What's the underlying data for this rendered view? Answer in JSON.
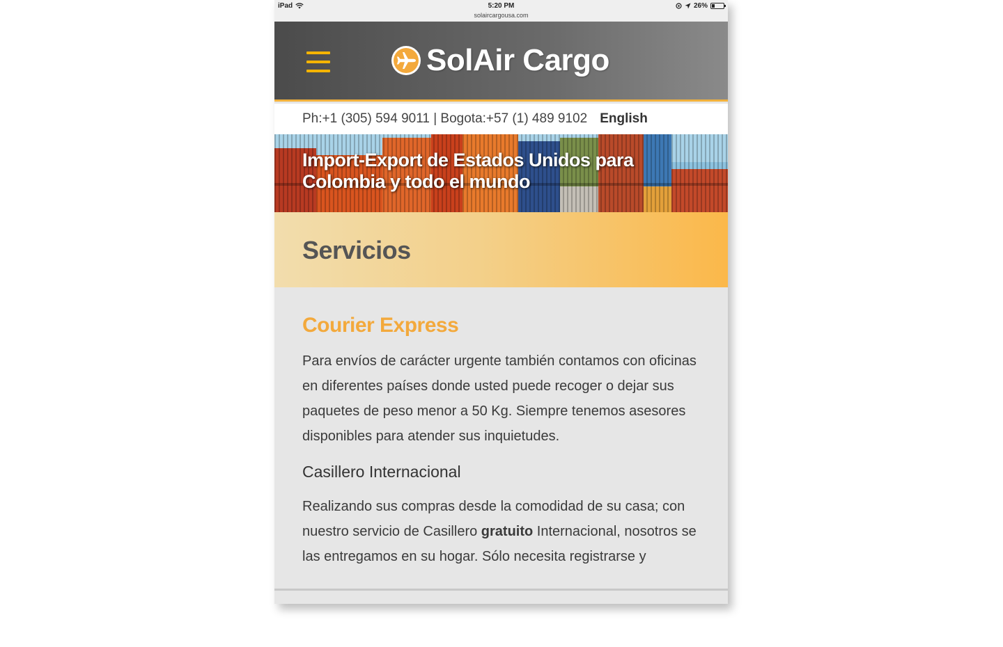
{
  "status_bar": {
    "device": "iPad",
    "time": "5:20 PM",
    "url": "solaircargousa.com",
    "battery": "26%"
  },
  "header": {
    "brand": "SolAir Cargo",
    "accent_color": "#f5b400"
  },
  "contact_bar": {
    "phones": "Ph:+1 (305) 594 9011 | Bogota:+57 (1) 489 9102",
    "language": "English"
  },
  "hero": {
    "title": "Import-Export de Estados Unidos para Colombia y todo el mundo"
  },
  "section": {
    "title": "Servicios"
  },
  "content": {
    "heading": "Courier Express",
    "paragraph1": "Para envíos de carácter urgente también contamos con oficinas en diferentes países donde usted puede recoger o dejar sus paquetes de peso menor a 50 Kg. Siempre tenemos asesores disponibles para atender sus inquietudes.",
    "subheading": "Casillero Internacional",
    "paragraph2_before": "Realizando sus compras desde la comodidad de su casa; con nuestro servicio de Casillero ",
    "paragraph2_bold": "gratuito",
    "paragraph2_after": " Internacional, nosotros se las entregamos en su hogar. Sólo necesita registrarse y"
  }
}
